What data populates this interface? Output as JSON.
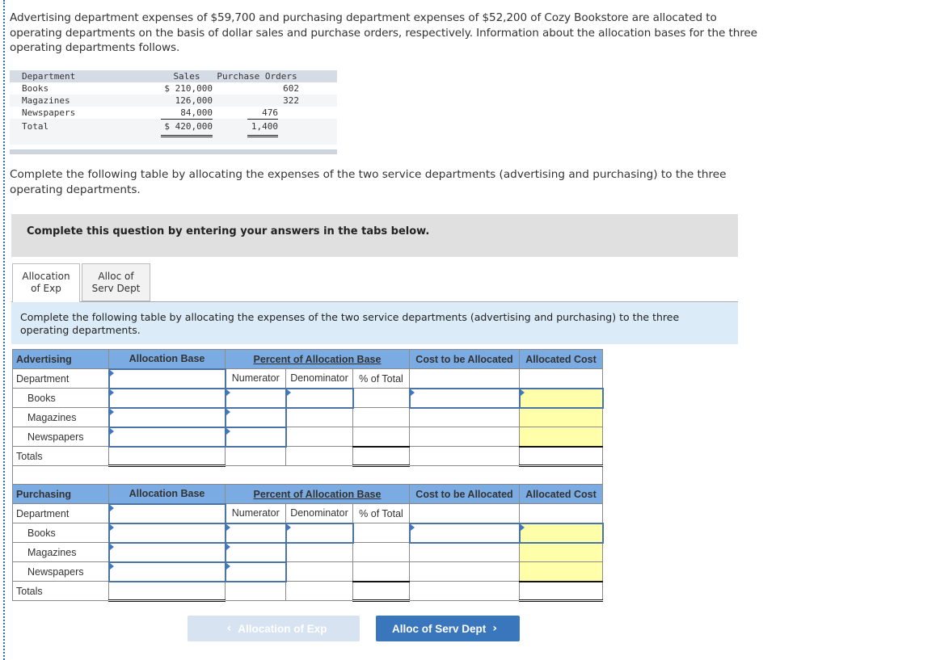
{
  "intro": "Advertising department expenses of $59,700 and purchasing department expenses of $52,200 of Cozy Bookstore are allocated to operating departments on the basis of dollar sales and purchase orders, respectively. Information about the allocation bases for the three operating departments follows.",
  "info_table": {
    "headers": [
      "Department",
      "Sales",
      "Purchase Orders"
    ],
    "rows": [
      {
        "dept": "Books",
        "sales": "$ 210,000",
        "po": "602"
      },
      {
        "dept": "Magazines",
        "sales": "126,000",
        "po": "322"
      },
      {
        "dept": "Newspapers",
        "sales": "84,000",
        "po": "476"
      }
    ],
    "total": {
      "dept": "Total",
      "sales": "$ 420,000",
      "po": "1,400"
    }
  },
  "instruction": "Complete the following table by allocating the expenses of the two service departments (advertising and purchasing) to the three operating departments.",
  "banner": "Complete this question by entering your answers in the tabs below.",
  "tabs": [
    {
      "label": "Allocation of Exp",
      "active": true
    },
    {
      "label": "Alloc of Serv Dept",
      "active": false
    }
  ],
  "tab_description": "Complete the following table by allocating the expenses of the two service departments (advertising and purchasing) to the three operating departments.",
  "grid_headers": {
    "allocation_base": "Allocation Base",
    "percent": "Percent of Allocation Base",
    "cost_to_allocate": "Cost to be Allocated",
    "allocated_cost": "Allocated Cost",
    "department": "Department",
    "numerator": "Numerator",
    "denominator": "Denominator",
    "pct_total": "% of Total",
    "totals": "Totals"
  },
  "sections": [
    {
      "title": "Advertising",
      "rows": [
        "Books",
        "Magazines",
        "Newspapers"
      ]
    },
    {
      "title": "Purchasing",
      "rows": [
        "Books",
        "Magazines",
        "Newspapers"
      ]
    }
  ],
  "nav": {
    "prev_label": "Allocation of Exp",
    "next_label": "Alloc of Serv Dept",
    "prev_icon": "chevron-left-icon",
    "next_icon": "chevron-right-icon"
  },
  "colors": {
    "header_blue": "#7aabe3",
    "input_border": "#4a73a8",
    "highlight_yellow": "#ffffaa",
    "next_button": "#3a76bb",
    "prev_button_disabled": "#d7e3f1",
    "banner_gray": "#e0e0e0",
    "description_blue": "#dbebf8"
  }
}
